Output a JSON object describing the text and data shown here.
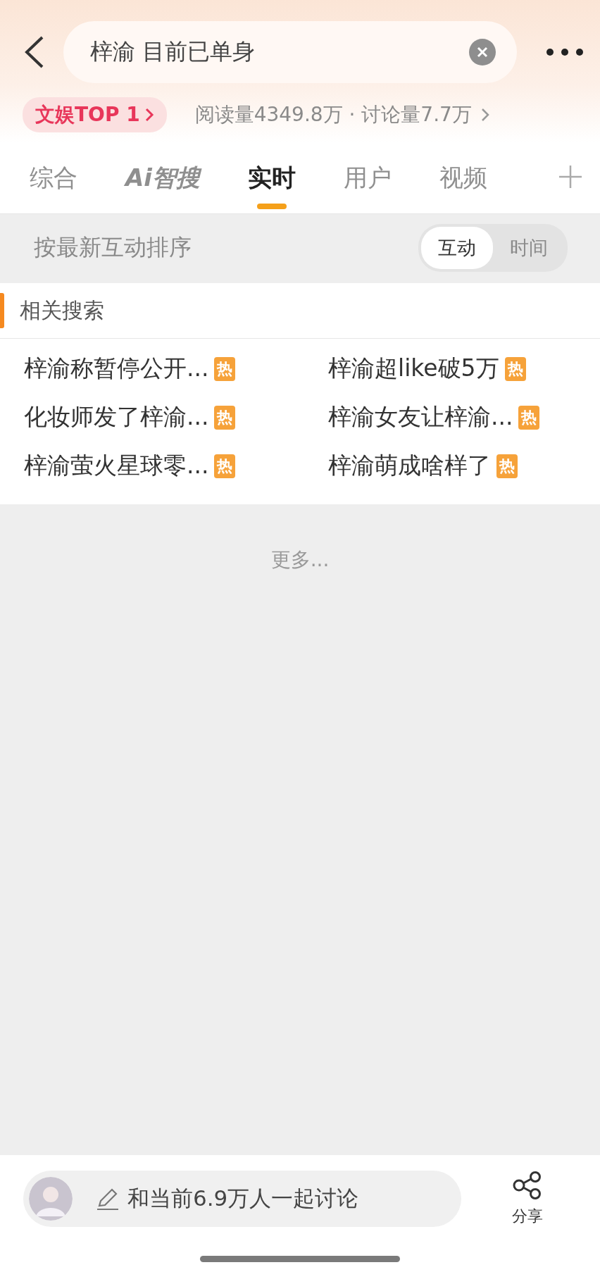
{
  "header": {
    "search": {
      "value": "梓渝 目前已单身"
    },
    "rank_badge": "文娱TOP 1",
    "stats": "阅读量4349.8万 · 讨论量7.7万"
  },
  "tabs": [
    {
      "label": "综合",
      "kind": "text",
      "selected": false
    },
    {
      "label": "Ai智搜",
      "kind": "ai",
      "selected": false
    },
    {
      "label": "实时",
      "kind": "text",
      "selected": true
    },
    {
      "label": "用户",
      "kind": "text",
      "selected": false
    },
    {
      "label": "视频",
      "kind": "text",
      "selected": false
    }
  ],
  "sort": {
    "label": "按最新互动排序",
    "options": [
      {
        "label": "互动",
        "selected": true
      },
      {
        "label": "时间",
        "selected": false
      }
    ]
  },
  "related": {
    "title": "相关搜索",
    "items": [
      {
        "text": "梓渝称暂停公开...",
        "badge": "热"
      },
      {
        "text": "梓渝超like破5万",
        "badge": "热"
      },
      {
        "text": "化妆师发了梓渝...",
        "badge": "热"
      },
      {
        "text": "梓渝女友让梓渝...",
        "badge": "热"
      },
      {
        "text": "梓渝萤火星球零...",
        "badge": "热"
      },
      {
        "text": "梓渝萌成啥样了",
        "badge": "热"
      }
    ]
  },
  "more": "更多...",
  "bottom": {
    "comment": {
      "placeholder": "和当前6.9万人一起讨论"
    },
    "share": "分享"
  }
}
